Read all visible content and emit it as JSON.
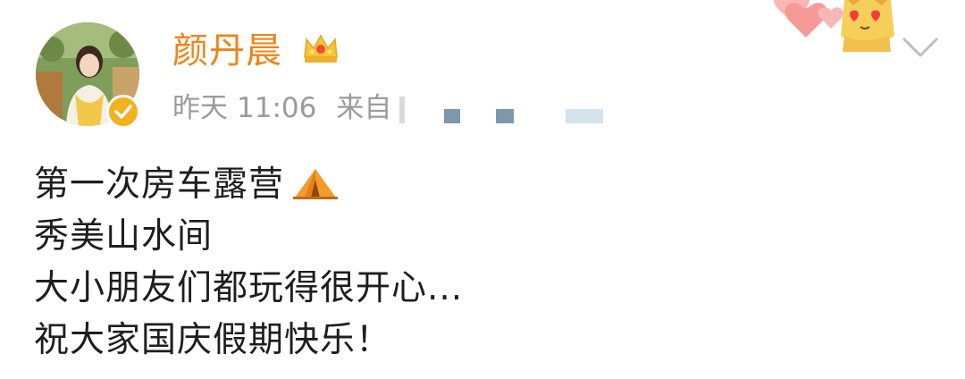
{
  "user": {
    "name": "颜丹晨",
    "verified": true,
    "avatar_icon": "avatar-photo",
    "badge_icon": "crown-icon"
  },
  "meta": {
    "day": "昨天",
    "time": "11:06",
    "source_prefix": "来自"
  },
  "post": {
    "lines": [
      "第一次房车露营",
      "秀美山水间",
      "大小朋友们都玩得很开心...",
      "祝大家国庆假期快乐！"
    ],
    "emoji_icon": "tent-icon"
  },
  "colors": {
    "username": "#f08418",
    "meta": "#9b9b9b",
    "text": "#1e1e1e",
    "verified_badge": "#f2b21e"
  }
}
